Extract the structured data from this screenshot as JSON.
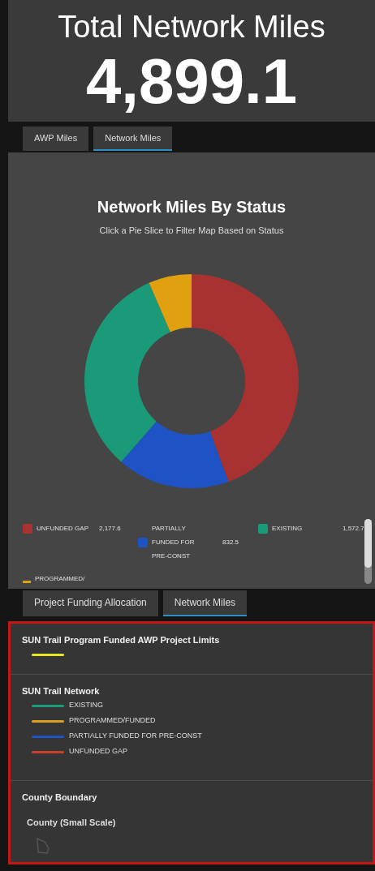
{
  "header": {
    "title": "Total Network Miles",
    "value": "4,899.1"
  },
  "top_tabs": [
    {
      "label": "AWP Miles",
      "selected": false
    },
    {
      "label": "Network Miles",
      "selected": true
    }
  ],
  "chart_panel": {
    "title": "Network Miles By Status",
    "subtitle": "Click a Pie Slice to Filter Map Based on Status",
    "chart_data": {
      "type": "donut",
      "series": [
        {
          "values": [
            44.4,
            17.0,
            32.1,
            6.5
          ]
        }
      ],
      "colors": [
        "#a83232",
        "#1f52c4",
        "#1a9a78",
        "#e0a010"
      ]
    },
    "legend": [
      {
        "label": "UNFUNDED GAP",
        "value": "2,177.6",
        "color": "#a83232"
      },
      {
        "label": "PARTIALLY FUNDED FOR PRE-CONST",
        "value": "832.5",
        "color": "#1f52c4"
      },
      {
        "label": "EXISTING",
        "value": "1,572.7",
        "color": "#1a9a78"
      },
      {
        "label": "PROGRAMMED/",
        "color": "#e0a010"
      }
    ]
  },
  "bottom_tabs": [
    {
      "label": "Project Funding Allocation",
      "selected": false
    },
    {
      "label": "Network Miles",
      "selected": true
    }
  ],
  "map_legend": [
    {
      "title": "SUN Trail Program Funded AWP Project Limits",
      "items": [
        {
          "color": "#e8e820"
        }
      ]
    },
    {
      "title": "SUN Trail Network",
      "items": [
        {
          "label": "EXISTING",
          "color": "#1a9a78"
        },
        {
          "label": "PROGRAMMED/FUNDED",
          "color": "#d9a020"
        },
        {
          "label": "PARTIALLY FUNDED FOR PRE-CONST",
          "color": "#1f52c4"
        },
        {
          "label": "UNFUNDED GAP",
          "color": "#c8402a"
        }
      ]
    },
    {
      "title": "County Boundary",
      "subtitle": "County (Small Scale)"
    }
  ]
}
